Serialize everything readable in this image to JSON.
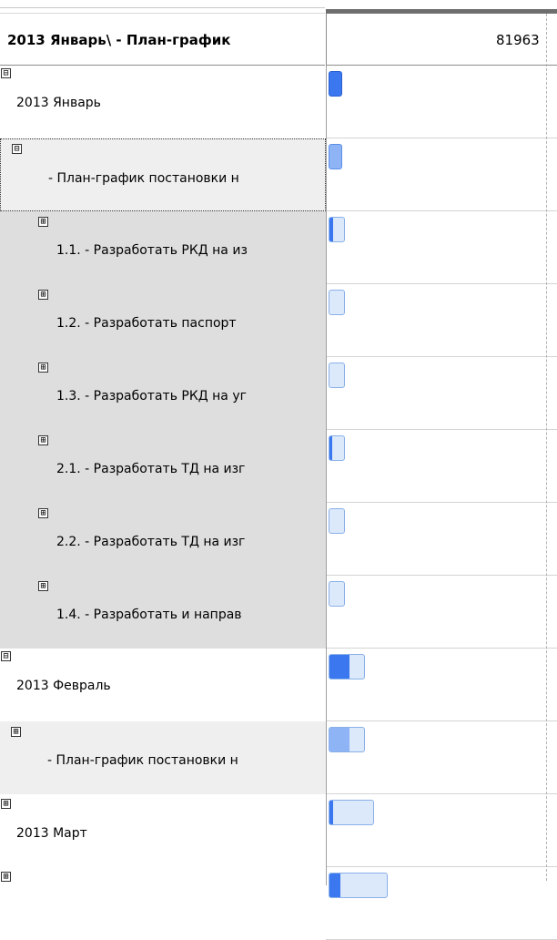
{
  "header": {
    "title": "2013 Январь\\ - План-график",
    "date_prefix": "81963"
  },
  "rows": [
    {
      "toggle": "⊟",
      "label": "2013 Январь"
    },
    {
      "toggle": "⊟",
      "label": "- План-график постановки н"
    },
    {
      "toggle": "⊞",
      "label": "1.1.  - Разработать РКД на из"
    },
    {
      "toggle": "⊞",
      "label": "1.2.  - Разработать паспорт"
    },
    {
      "toggle": "⊞",
      "label": "1.3.  - Разработать РКД на уг"
    },
    {
      "toggle": "⊞",
      "label": "2.1.  - Разработать ТД на изг"
    },
    {
      "toggle": "⊞",
      "label": "2.2.  - Разработать ТД на изг"
    },
    {
      "toggle": "⊞",
      "label": "1.4.  - Разработать и направ"
    },
    {
      "toggle": "⊟",
      "label": "2013 Февраль"
    },
    {
      "toggle": "⊞",
      "label": "- План-график постановки н"
    },
    {
      "toggle": "⊞",
      "label": "2013 Март"
    },
    {
      "toggle": "⊞",
      "label": ""
    }
  ],
  "colors": {
    "row_bg_white": "#ffffff",
    "row_bg_light": "#efefef",
    "row_bg_grey": "#dedede",
    "bar_solid": "#3b78f0",
    "bar_light": "#dbe9fb"
  }
}
